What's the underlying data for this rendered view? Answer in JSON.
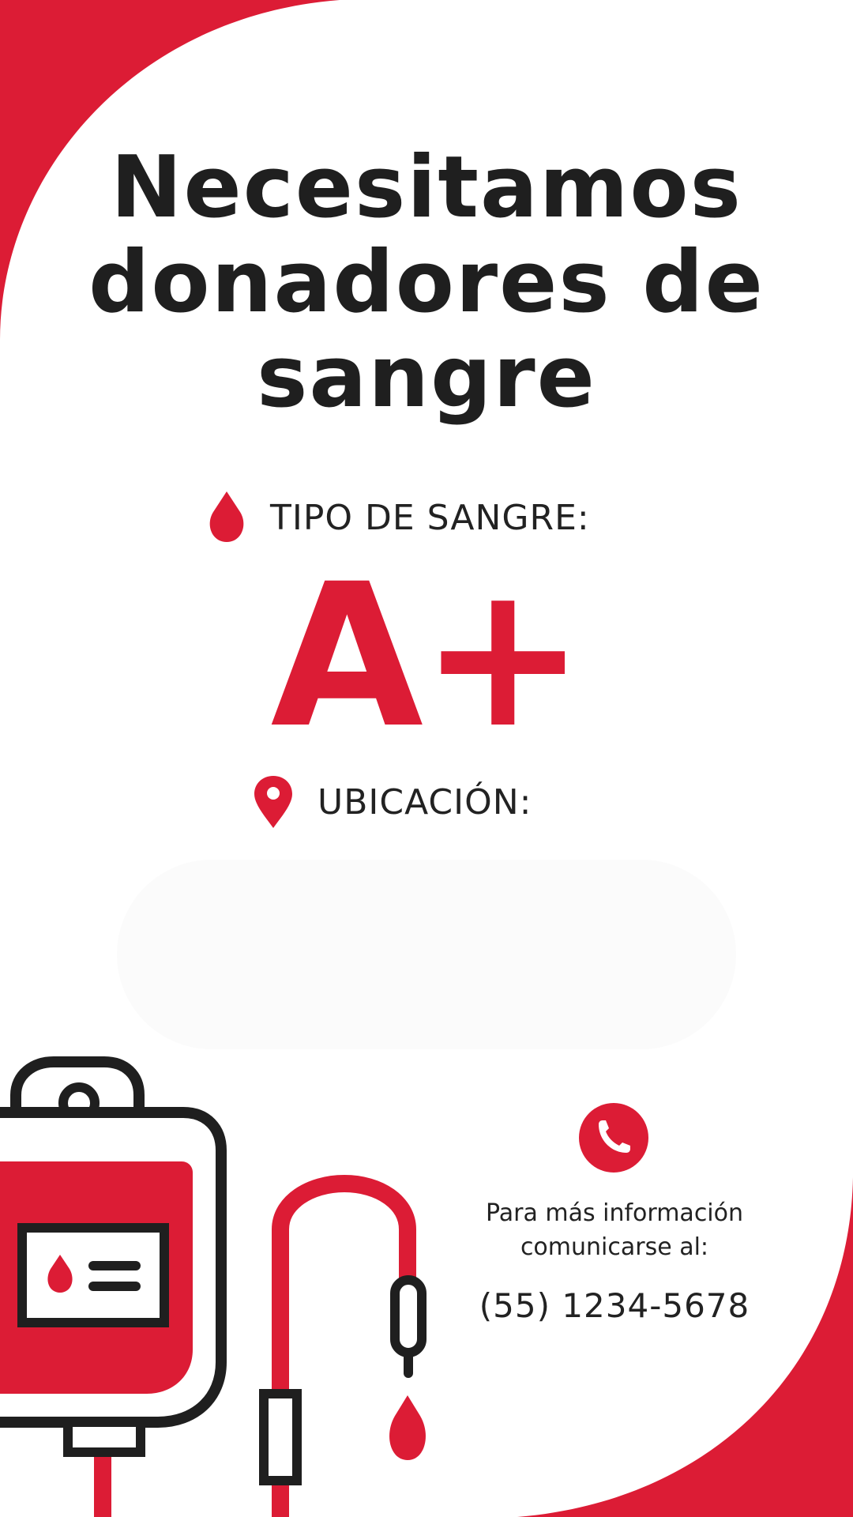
{
  "colors": {
    "accent": "#dc1c35",
    "text": "#1f1f1f",
    "background": "#ffffff"
  },
  "title": {
    "line1": "Necesitamos",
    "line2": "donadores de",
    "line3": "sangre"
  },
  "blood": {
    "label": "TIPO DE SANGRE:",
    "icon": "blood-drop-icon",
    "type": "A+"
  },
  "location": {
    "label": "UBICACIÓN:",
    "icon": "map-pin-icon",
    "value": ""
  },
  "contact": {
    "icon": "phone-icon",
    "line1": "Para más información",
    "line2": "comunicarse al:",
    "phone": "(55) 1234-5678"
  },
  "illustration": {
    "icon": "blood-bag-icon"
  }
}
